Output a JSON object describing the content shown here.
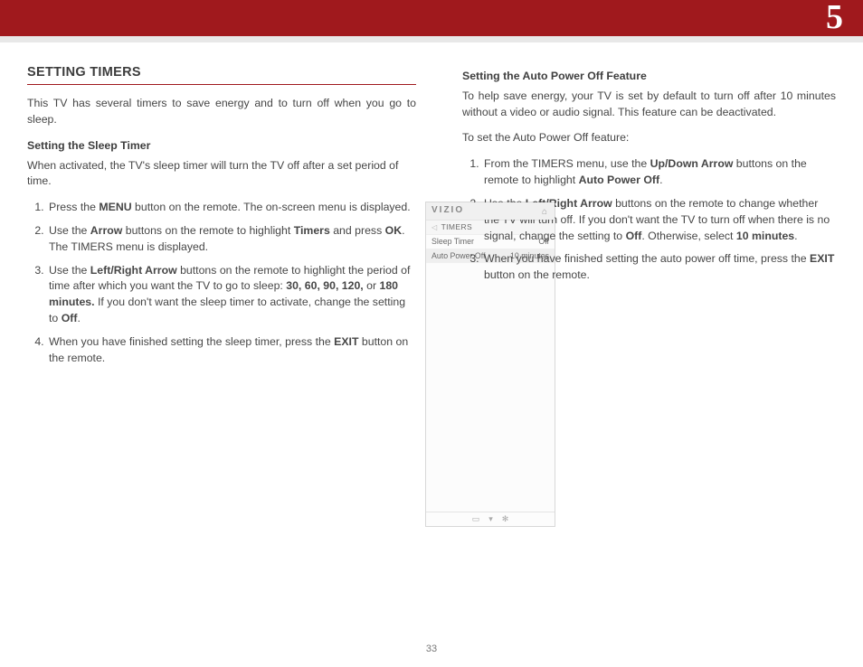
{
  "chapter_number": "5",
  "page_number": "33",
  "left": {
    "heading": "SETTING TIMERS",
    "intro": "This TV has several timers to save energy and to turn off when you go to sleep.",
    "subhead": "Setting the Sleep Timer",
    "sub_intro": "When activated, the TV's sleep timer will turn the TV off after a set period of time.",
    "steps": {
      "s1a": "Press the ",
      "s1b": "MENU",
      "s1c": " button on the remote. The on-screen menu is displayed.",
      "s2a": "Use the ",
      "s2b": "Arrow",
      "s2c": " buttons on the remote to highlight ",
      "s2d": "Timers",
      "s2e": " and press ",
      "s2f": "OK",
      "s2g": ". The TIMERS menu is displayed.",
      "s3a": "Use the ",
      "s3b": "Left/Right Arrow",
      "s3c": " buttons on the remote to highlight the period of time after which you want the TV to go to sleep: ",
      "s3d": "30, 60, 90, 120,",
      "s3e": " or ",
      "s3f": "180 minutes.",
      "s3g": " If you don't want the sleep timer to activate, change the setting to ",
      "s3h": "Off",
      "s3i": ".",
      "s4a": "When you have finished setting the sleep timer, press the ",
      "s4b": "EXIT",
      "s4c": " button on the remote."
    }
  },
  "osd": {
    "brand": "VIZIO",
    "crumb": "TIMERS",
    "rows": [
      {
        "label": "Sleep Timer",
        "value": "Off"
      },
      {
        "label": "Auto Power Off",
        "value": "10 minutes"
      }
    ]
  },
  "right": {
    "subhead": "Setting the Auto Power Off Feature",
    "intro": "To help save energy, your TV is set by default to turn off after 10 minutes without a video or audio signal. This feature can be deactivated.",
    "lead": "To set the Auto Power Off feature:",
    "steps": {
      "s1a": "From the TIMERS menu, use the ",
      "s1b": "Up/Down Arrow",
      "s1c": " buttons on the remote to highlight ",
      "s1d": "Auto Power Off",
      "s1e": ".",
      "s2a": "Use the ",
      "s2b": "Left/Right Arrow",
      "s2c": " buttons on the remote to change whether the TV will turn off. If you don't want the TV to turn off when there is no signal, change the setting to ",
      "s2d": "Off",
      "s2e": ". Otherwise, select ",
      "s2f": "10 minutes",
      "s2g": ".",
      "s3a": "When you have finished setting the auto power off time, press the ",
      "s3b": "EXIT",
      "s3c": " button on the remote."
    }
  }
}
